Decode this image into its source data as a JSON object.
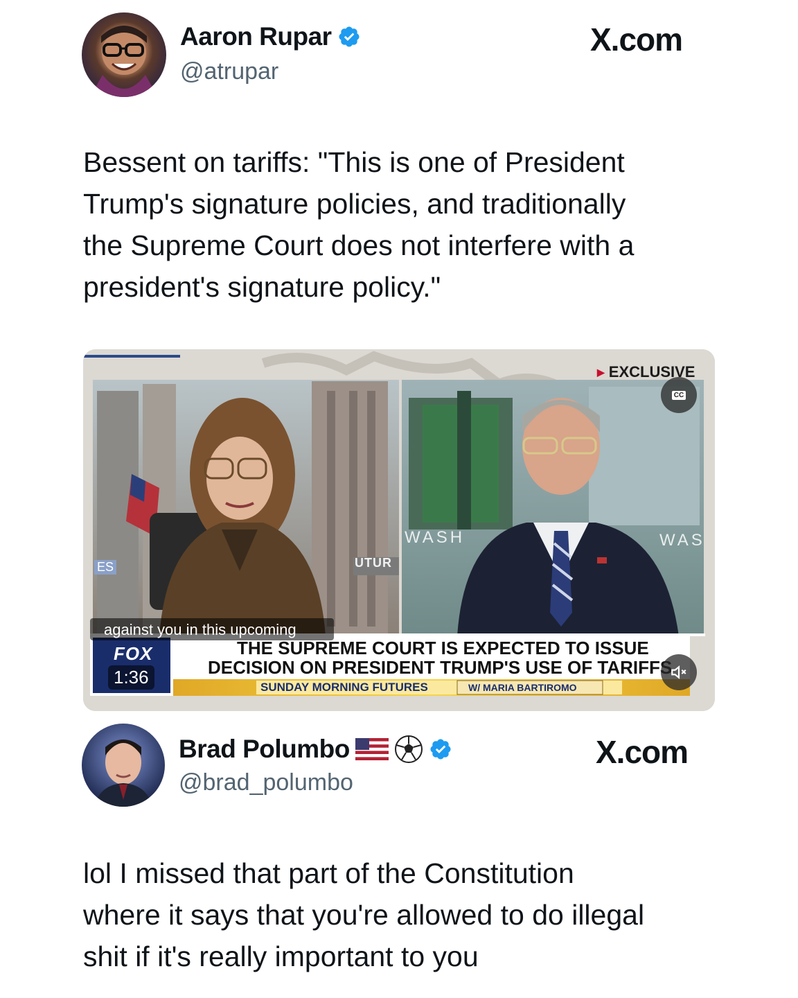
{
  "tweet1": {
    "name": "Aaron Rupar",
    "handle": "@atrupar",
    "source": "X.com",
    "text_lines": [
      "Bessent on tariffs: \"This is one of President",
      "Trump's signature policies, and traditionally",
      "the Supreme Court does not interfere with a",
      "president's signature policy.\""
    ]
  },
  "video": {
    "exclusive_label": "EXCLUSIVE",
    "cc_label": "CC",
    "caption": "against you in this upcoming",
    "headline_line1": "THE SUPREME COURT IS EXPECTED TO ISSUE",
    "headline_line2": "DECISION ON PRESIDENT TRUMP'S USE OF TARIFFS",
    "show_name": "SUNDAY MORNING FUTURES",
    "show_host": "W/ MARIA BARTIROMO",
    "network_logo": "FOX",
    "timestamp": "1:36",
    "left_wall_text": "UTUR",
    "left_edge_text": "ES",
    "right_wall_text1": "WASH",
    "right_wall_text2": "WAS",
    "icons": {
      "exclusive": "play-triangle-icon",
      "mute": "speaker-muted-icon"
    }
  },
  "tweet2": {
    "name": "Brad Polumbo",
    "handle": "@brad_polumbo",
    "source": "X.com",
    "name_emoji": [
      "us-flag-icon",
      "soccer-ball-icon"
    ],
    "text_lines": [
      "lol I missed that part of the Constitution",
      "where it says that you're allowed to do illegal",
      "shit if it's really important to you"
    ]
  },
  "colors": {
    "verified": "#1d9bf0",
    "handle": "#536471",
    "text": "#0f1419",
    "fox_blue": "#1a2d6b"
  }
}
